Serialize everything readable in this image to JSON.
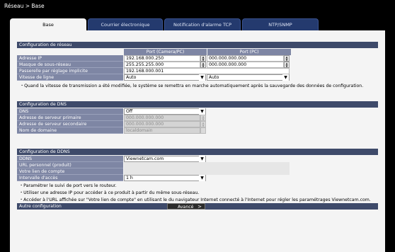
{
  "breadcrumb": "Réseau > Base",
  "tabs": [
    "Base",
    "Courrier électronique",
    "Notification d'alarme TCP",
    "NTP/SNMP"
  ],
  "network": {
    "title": "Configuration de réseau",
    "col_camera": "Port (Camera/PC)",
    "col_pc": "Port (PC)",
    "rows": [
      {
        "label": "Adresse IP",
        "camera": "192.168.000.250",
        "pc": "000.000.000.000"
      },
      {
        "label": "Masque de sous-réseau",
        "camera": "255.255.255.000",
        "pc": "000.000.000.000"
      },
      {
        "label": "Passerelle par réglage implicite",
        "camera": "192.168.000.001"
      },
      {
        "label": "Vitesse de ligne",
        "camera": "Auto",
        "pc": "Auto"
      }
    ],
    "note": "・Quand la vitesse de transmission a été modifiée, le système se remettra en marche automatiquement après la sauvegarde des données de configuration."
  },
  "dns": {
    "title": "Configuration de DNS",
    "rows": [
      {
        "label": "DNS",
        "value": "Off"
      },
      {
        "label": "Adresse de serveur primaire",
        "value": "000.000.000.000"
      },
      {
        "label": "Adresse de serveur secondaire",
        "value": "000.000.000.000"
      },
      {
        "label": "Nom de domaine",
        "value": "localdomain"
      }
    ]
  },
  "ddns": {
    "title": "Configuration de DDNS",
    "rows": [
      {
        "label": "DDNS",
        "value": "Viewnetcam.com"
      },
      {
        "label": "URL personnel (produit)",
        "value": ""
      },
      {
        "label": "Votre lien de compte",
        "value": ""
      },
      {
        "label": "Intervalle d'accès",
        "value": "1 h"
      }
    ],
    "notes": [
      "・Paramétrer le suivi de port vers le routeur.",
      "・Utiliser une adresse IP pour accéder à ce produit à partir du même sous-réseau.",
      "・Accéder à l'URL affichée sur \"Votre lien de compte\" en utilisant le du navigateur Internet connecté à l'Internet pour régler les paramétrages Viewnetcam.com."
    ]
  },
  "auto": {
    "label": "Autre configuration",
    "button": "Avancé",
    "chevron": ">"
  },
  "icons": {
    "spin_up": "▲",
    "spin_down": "▼",
    "dropdown": "▼"
  }
}
